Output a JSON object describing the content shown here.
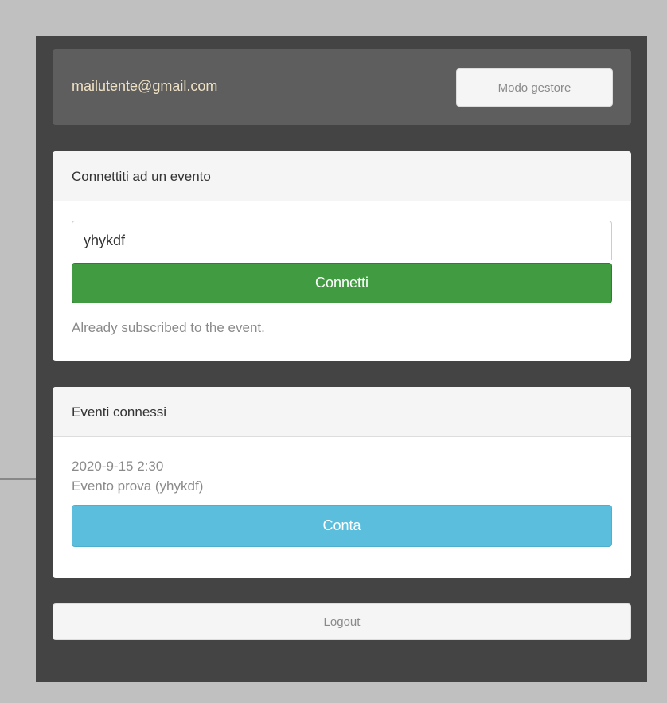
{
  "user_bar": {
    "email": "mailutente@gmail.com",
    "manager_mode_label": "Modo gestore"
  },
  "connect_panel": {
    "title": "Connettiti ad un evento",
    "event_code_value": "yhykdf",
    "connect_label": "Connetti",
    "status_message": "Already subscribed to the event."
  },
  "events_panel": {
    "title": "Eventi connessi",
    "events": [
      {
        "datetime": "2020-9-15 2:30",
        "name": "Evento prova (yhykdf)",
        "count_label": "Conta"
      }
    ]
  },
  "logout_label": "Logout",
  "colors": {
    "background": "#c0c0c0",
    "app_frame": "#444444",
    "user_bar": "#5e5e5e",
    "email_text": "#efe1c4",
    "connect_button": "#409b41",
    "count_button": "#5bbedc"
  }
}
